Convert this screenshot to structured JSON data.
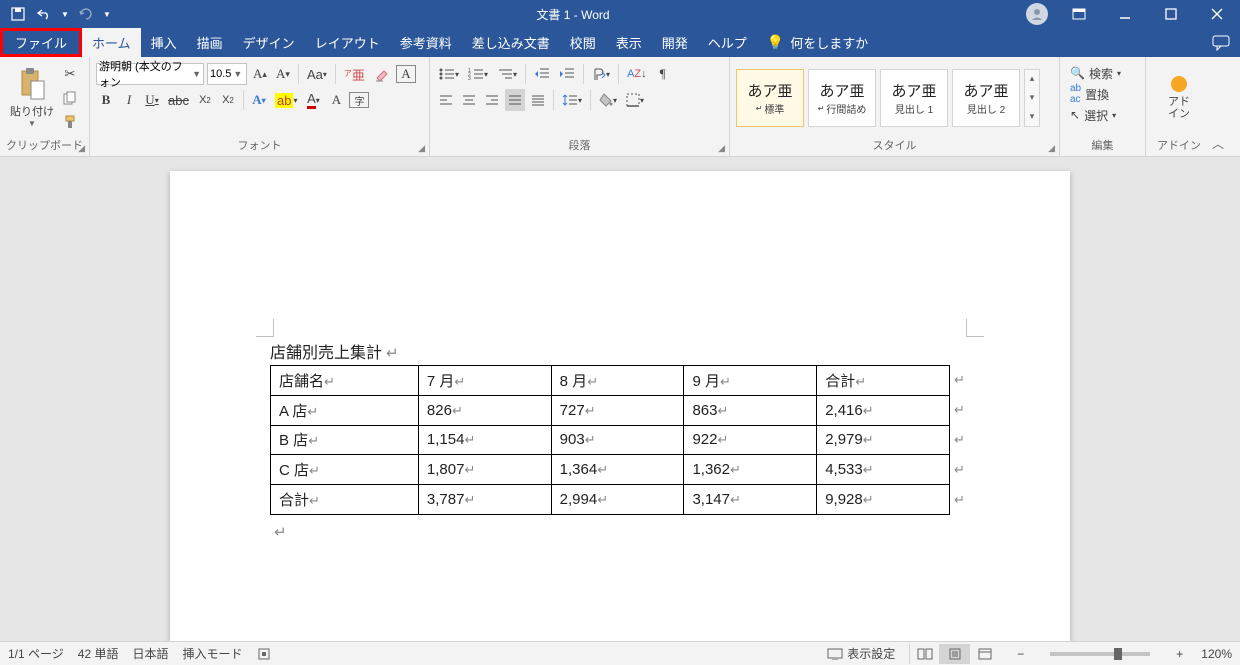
{
  "title_bar": {
    "doc_title": "文書 1  -  Word",
    "qat": {
      "save": "save",
      "undo": "undo",
      "redo": "redo"
    }
  },
  "tabs": {
    "file": "ファイル",
    "items": [
      "ホーム",
      "挿入",
      "描画",
      "デザイン",
      "レイアウト",
      "参考資料",
      "差し込み文書",
      "校閲",
      "表示",
      "開発",
      "ヘルプ"
    ],
    "tell_me": "何をしますか"
  },
  "ribbon": {
    "clipboard": {
      "label": "クリップボード",
      "paste": "貼り付け"
    },
    "font": {
      "label": "フォント",
      "font_name": "游明朝 (本文のフォン",
      "font_size": "10.5"
    },
    "paragraph": {
      "label": "段落"
    },
    "styles": {
      "label": "スタイル",
      "items": [
        {
          "sample": "あア亜",
          "name": "標準"
        },
        {
          "sample": "あア亜",
          "name": "行間詰め"
        },
        {
          "sample": "あア亜",
          "name": "見出し 1"
        },
        {
          "sample": "あア亜",
          "name": "見出し 2"
        }
      ]
    },
    "editing": {
      "label": "編集",
      "find": "検索",
      "replace": "置換",
      "select": "選択"
    },
    "addins": {
      "label": "アドイン",
      "btn": "アド\nイン"
    }
  },
  "document": {
    "heading": "店舗別売上集計",
    "table": {
      "rows": [
        [
          "店舗名",
          "7 月",
          "8 月",
          "9 月",
          "合計"
        ],
        [
          "A 店",
          "826",
          "727",
          "863",
          "2,416"
        ],
        [
          "B 店",
          "1,154",
          "903",
          "922",
          "2,979"
        ],
        [
          "C 店",
          "1,807",
          "1,364",
          "1,362",
          "4,533"
        ],
        [
          "合計",
          "3,787",
          "2,994",
          "3,147",
          "9,928"
        ]
      ]
    }
  },
  "statusbar": {
    "page": "1/1 ページ",
    "words": "42 単語",
    "lang": "日本語",
    "insert": "挿入モード",
    "display": "表示設定",
    "zoom": "120%"
  }
}
